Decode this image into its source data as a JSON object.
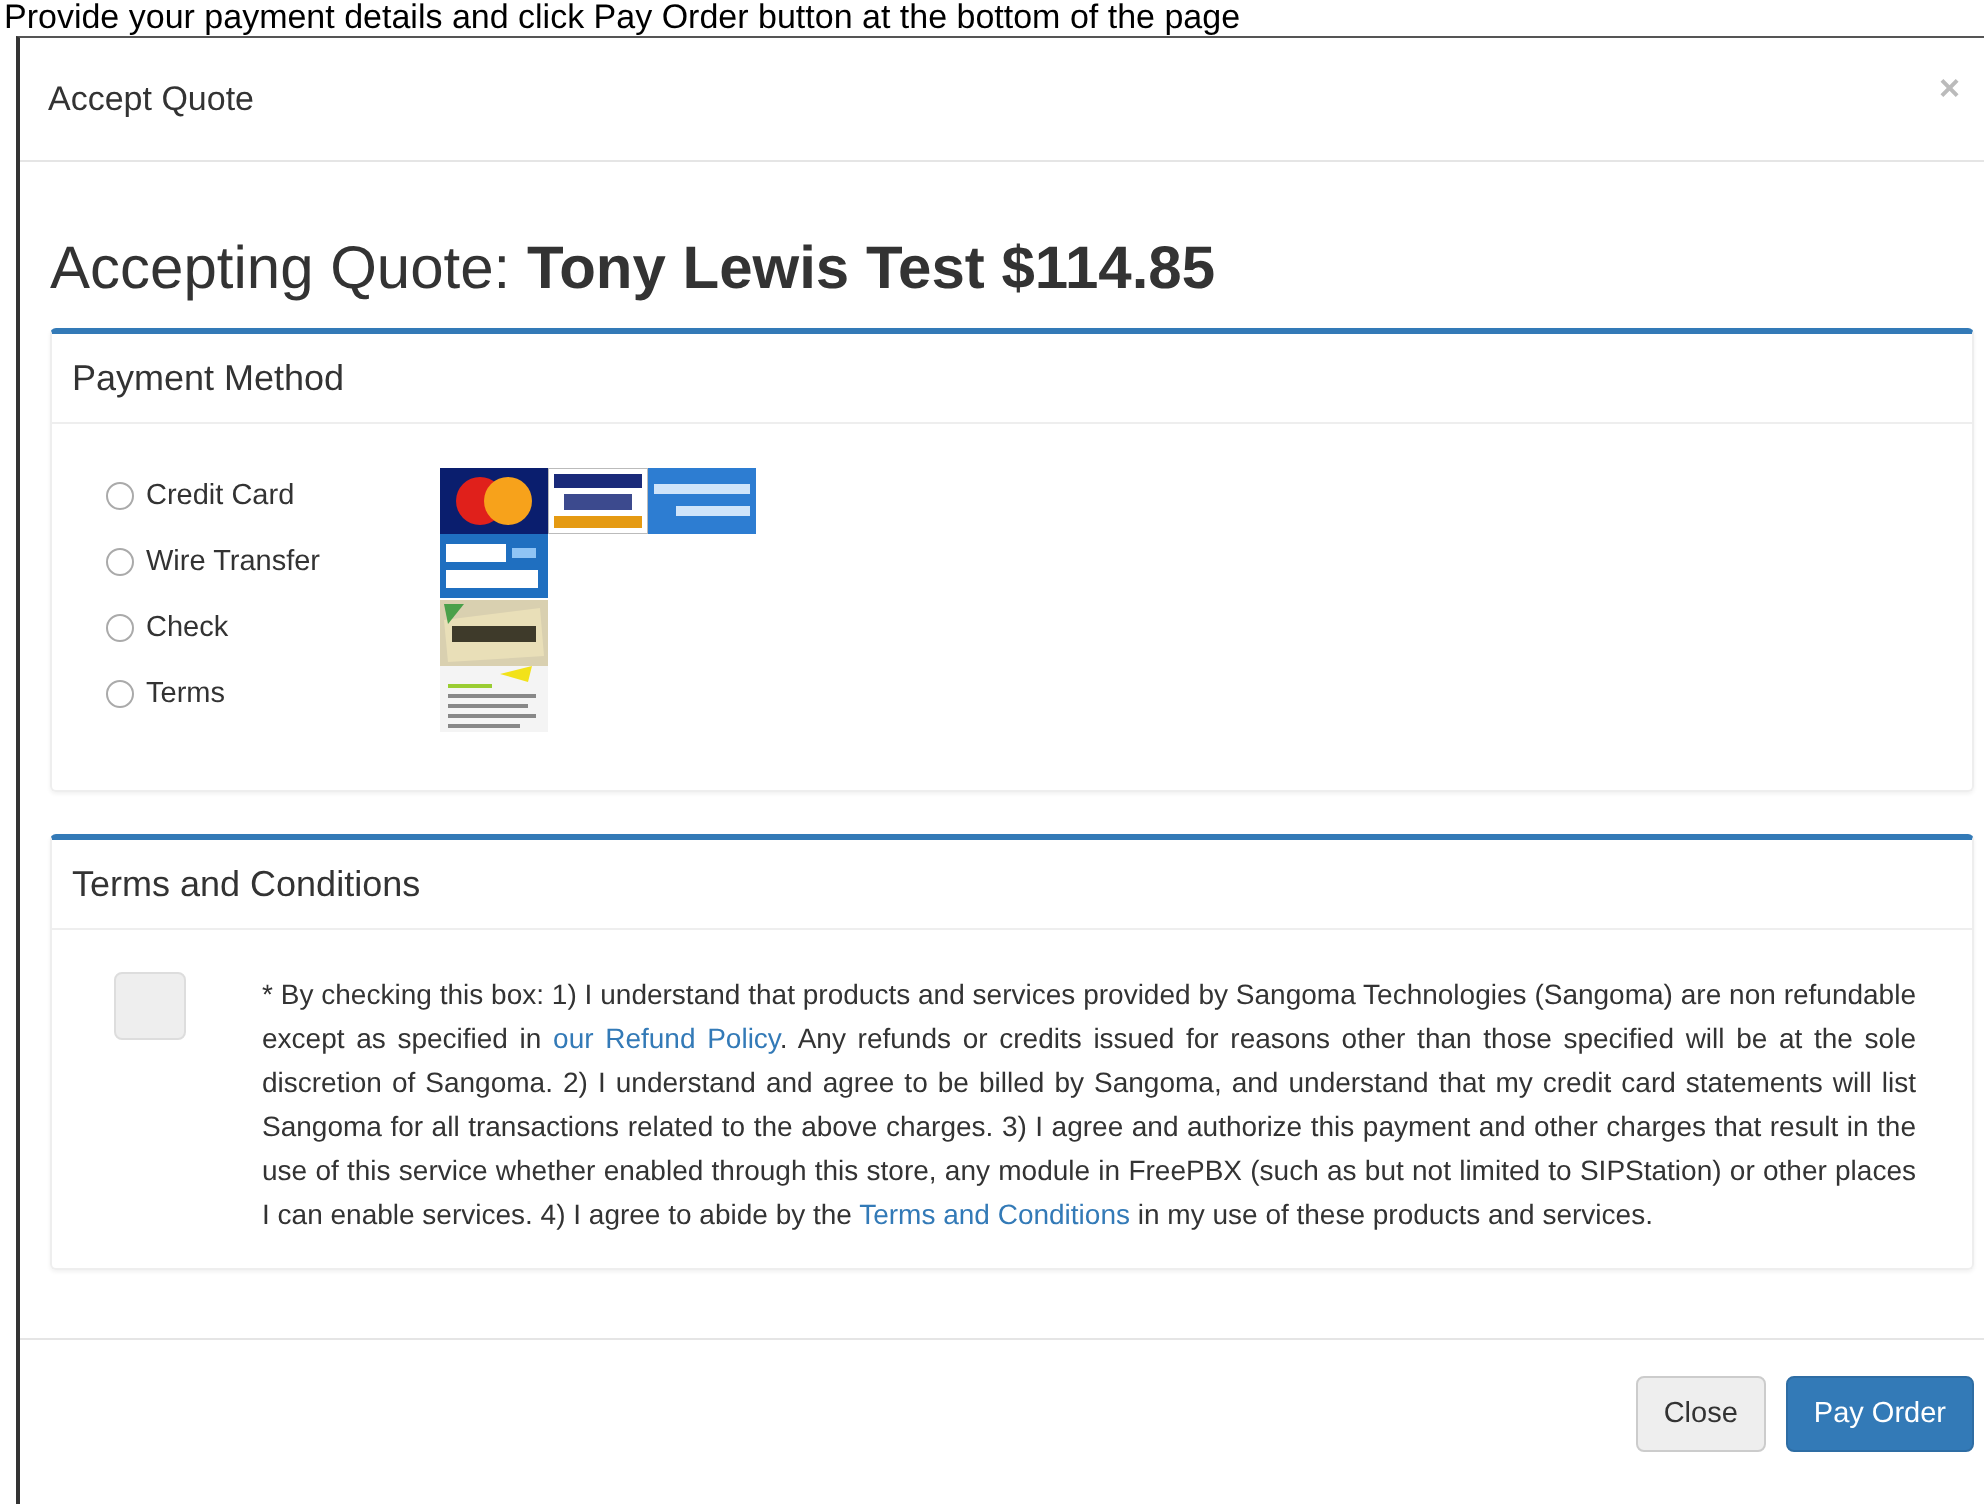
{
  "instruction": "Provide your payment details and click Pay Order button at the bottom of the page",
  "modal": {
    "title": "Accept Quote",
    "close_glyph": "×"
  },
  "heading": {
    "prefix": "Accepting Quote: ",
    "name": "Tony Lewis Test $114.85"
  },
  "payment_panel": {
    "title": "Payment Method",
    "methods": [
      {
        "label": "Credit Card",
        "selected": false,
        "logos": [
          {
            "kind": "mastercard"
          },
          {
            "kind": "visa"
          },
          {
            "kind": "amex"
          }
        ]
      },
      {
        "label": "Wire Transfer",
        "selected": false,
        "logos": [
          {
            "kind": "wire"
          }
        ]
      },
      {
        "label": "Check",
        "selected": false,
        "logos": [
          {
            "kind": "check"
          }
        ]
      },
      {
        "label": "Terms",
        "selected": false,
        "logos": [
          {
            "kind": "terms"
          }
        ]
      }
    ]
  },
  "terms_panel": {
    "title": "Terms and Conditions",
    "checked": false,
    "parts": [
      {
        "kind": "text",
        "text": "* By checking this box: 1) I understand that products and services provided by Sangoma Technologies (Sangoma) are non refundable except as specified in "
      },
      {
        "kind": "link",
        "text": "our Refund Policy"
      },
      {
        "kind": "text",
        "text": ". Any refunds or credits issued for reasons other than those specified will be at the sole discretion of Sangoma. 2) I understand and agree to be billed by Sangoma, and understand that my credit card statements will list Sangoma for all transactions related to the above charges. 3) I agree and authorize this payment and other charges that result in the use of this service whether enabled through this store, any module in FreePBX (such as but not limited to SIPStation) or other places I can enable services. 4) I agree to abide by the "
      },
      {
        "kind": "link",
        "text": "Terms and Conditions"
      },
      {
        "kind": "text",
        "text": " in my use of these products and services."
      }
    ]
  },
  "buttons": [
    {
      "label": "Close",
      "kind": "default"
    },
    {
      "label": "Pay Order",
      "kind": "primary"
    }
  ]
}
